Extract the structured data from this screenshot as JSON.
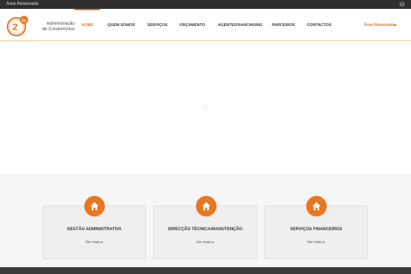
{
  "topbar": {
    "reserved_area": "Área Reservada",
    "social_icon": "facebook-icon"
  },
  "logo": {
    "line1": "Administração",
    "line2": "de Condomínios",
    "accent_color": "#e87722"
  },
  "nav": {
    "items": [
      {
        "label": "HOME",
        "active": true
      },
      {
        "label": "QUEM SOMOS",
        "active": false
      },
      {
        "label": "SERVIÇOS",
        "active": false
      },
      {
        "label": "ORÇAMENTO",
        "active": false
      },
      {
        "label": "AGENTE/FRANCHISING",
        "active": false
      },
      {
        "label": "PARCEIROS",
        "active": false
      },
      {
        "label": "CONTACTOS",
        "active": false
      }
    ],
    "reserved_area": "Área Reservada",
    "active_color": "#e87722"
  },
  "services": [
    {
      "title": "GESTÃO ADMINISTRATIVA",
      "more": "Ver mais",
      "icon": "home-icon"
    },
    {
      "title": "DIRECÇÃO TÉCNICA/MANUTENÇÃO",
      "more": "Ver mais",
      "icon": "home-icon"
    },
    {
      "title": "SERVIÇOS FINANCEIROS",
      "more": "Ver mais",
      "icon": "home-icon"
    }
  ]
}
